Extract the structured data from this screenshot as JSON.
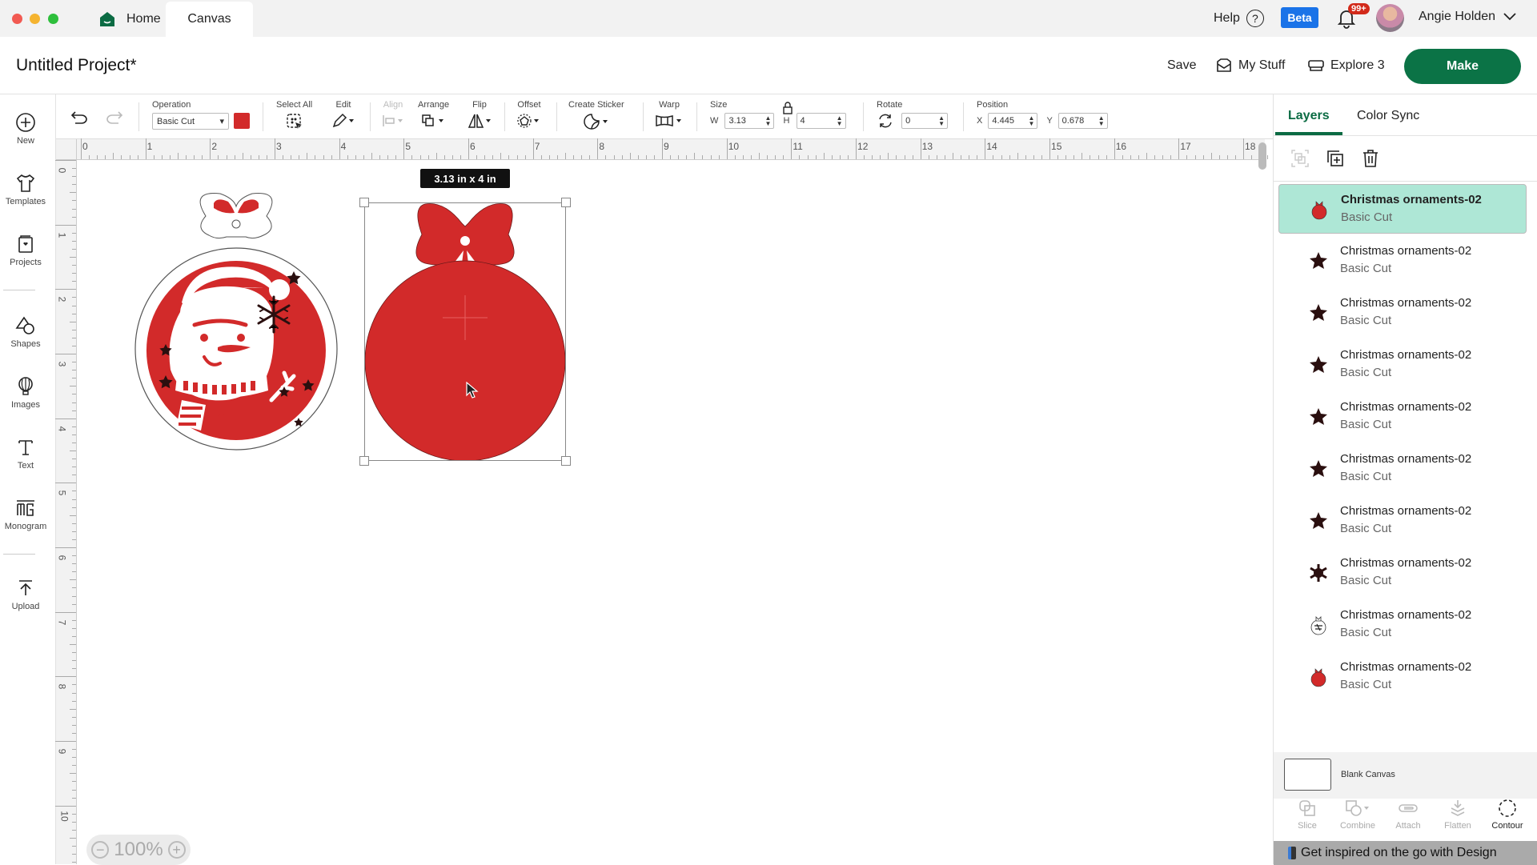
{
  "window": {
    "tabs": [
      {
        "label": "Home",
        "icon": "home-icon",
        "active": false
      },
      {
        "label": "Canvas",
        "active": true
      }
    ],
    "help_label": "Help",
    "beta_label": "Beta",
    "notification_count": "99+",
    "user_name": "Angie Holden"
  },
  "header": {
    "project_title": "Untitled Project*",
    "save_label": "Save",
    "mystuff_label": "My Stuff",
    "machine_label": "Explore 3",
    "make_label": "Make"
  },
  "sidebar": {
    "items": [
      {
        "label": "New",
        "icon": "plus-circle-icon"
      },
      {
        "label": "Templates",
        "icon": "tshirt-icon"
      },
      {
        "label": "Projects",
        "icon": "projects-icon"
      },
      {
        "label": "Shapes",
        "icon": "shapes-icon"
      },
      {
        "label": "Images",
        "icon": "lightbulb-icon"
      },
      {
        "label": "Text",
        "icon": "text-icon"
      },
      {
        "label": "Monogram",
        "icon": "monogram-icon"
      },
      {
        "label": "Upload",
        "icon": "upload-icon"
      }
    ]
  },
  "toolbar": {
    "operation_label": "Operation",
    "operation_value": "Basic Cut",
    "operation_color": "#d22a2a",
    "select_all_label": "Select All",
    "edit_label": "Edit",
    "align_label": "Align",
    "arrange_label": "Arrange",
    "flip_label": "Flip",
    "offset_label": "Offset",
    "create_sticker_label": "Create Sticker",
    "warp_label": "Warp",
    "size_label": "Size",
    "w_label": "W",
    "w_value": "3.13",
    "h_label": "H",
    "h_value": "4",
    "rotate_label": "Rotate",
    "rotate_value": "0",
    "position_label": "Position",
    "x_label": "X",
    "x_value": "4.445",
    "y_label": "Y",
    "y_value": "0.678"
  },
  "canvas": {
    "ruler_h": [
      "0",
      "1",
      "2",
      "3",
      "4",
      "5",
      "6",
      "7",
      "8",
      "9",
      "10",
      "11",
      "12",
      "13",
      "14",
      "15",
      "16",
      "17",
      "18"
    ],
    "ruler_v": [
      "0",
      "1",
      "2",
      "3",
      "4",
      "5",
      "6",
      "7",
      "8",
      "9",
      "10"
    ],
    "size_tooltip": "3.13  in x 4  in",
    "zoom_level": "100%",
    "accent_red": "#d22a2a"
  },
  "layers_panel": {
    "tabs": [
      {
        "label": "Layers",
        "active": true
      },
      {
        "label": "Color Sync",
        "active": false
      }
    ],
    "layers": [
      {
        "name": "Christmas ornaments-02",
        "operation": "Basic Cut",
        "thumb": "red-ornament",
        "selected": true
      },
      {
        "name": "Christmas ornaments-02",
        "operation": "Basic Cut",
        "thumb": "star",
        "selected": false
      },
      {
        "name": "Christmas ornaments-02",
        "operation": "Basic Cut",
        "thumb": "star",
        "selected": false
      },
      {
        "name": "Christmas ornaments-02",
        "operation": "Basic Cut",
        "thumb": "star",
        "selected": false
      },
      {
        "name": "Christmas ornaments-02",
        "operation": "Basic Cut",
        "thumb": "star",
        "selected": false
      },
      {
        "name": "Christmas ornaments-02",
        "operation": "Basic Cut",
        "thumb": "star",
        "selected": false
      },
      {
        "name": "Christmas ornaments-02",
        "operation": "Basic Cut",
        "thumb": "star",
        "selected": false
      },
      {
        "name": "Christmas ornaments-02",
        "operation": "Basic Cut",
        "thumb": "snowflake",
        "selected": false
      },
      {
        "name": "Christmas ornaments-02",
        "operation": "Basic Cut",
        "thumb": "snowman-outline",
        "selected": false
      },
      {
        "name": "Christmas ornaments-02",
        "operation": "Basic Cut",
        "thumb": "red-ornament",
        "selected": false
      }
    ],
    "blank_canvas_label": "Blank Canvas",
    "actions": [
      {
        "label": "Slice",
        "enabled": false
      },
      {
        "label": "Combine",
        "enabled": false
      },
      {
        "label": "Attach",
        "enabled": false
      },
      {
        "label": "Flatten",
        "enabled": false
      },
      {
        "label": "Contour",
        "enabled": true
      }
    ],
    "banner_text": "Get inspired on the go with Design"
  }
}
